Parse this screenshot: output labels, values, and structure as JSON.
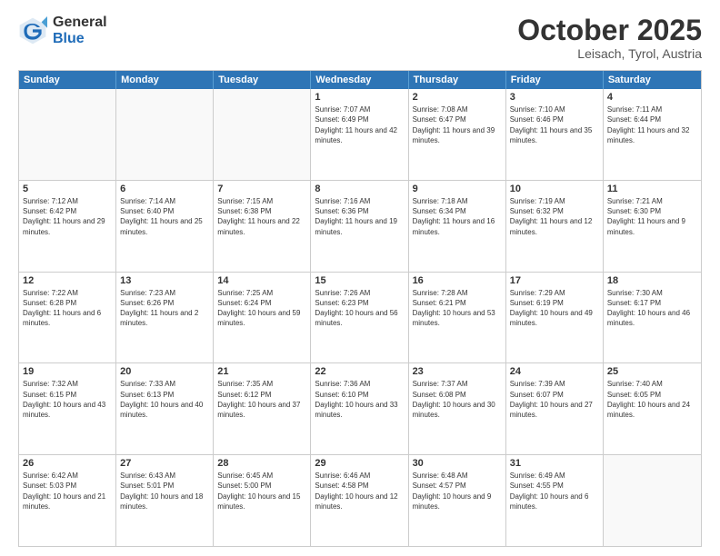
{
  "header": {
    "logo_general": "General",
    "logo_blue": "Blue",
    "month_title": "October 2025",
    "location": "Leisach, Tyrol, Austria"
  },
  "days_of_week": [
    "Sunday",
    "Monday",
    "Tuesday",
    "Wednesday",
    "Thursday",
    "Friday",
    "Saturday"
  ],
  "rows": [
    [
      {
        "day": "",
        "empty": true
      },
      {
        "day": "",
        "empty": true
      },
      {
        "day": "",
        "empty": true
      },
      {
        "day": "1",
        "sunrise": "7:07 AM",
        "sunset": "6:49 PM",
        "daylight": "11 hours and 42 minutes."
      },
      {
        "day": "2",
        "sunrise": "7:08 AM",
        "sunset": "6:47 PM",
        "daylight": "11 hours and 39 minutes."
      },
      {
        "day": "3",
        "sunrise": "7:10 AM",
        "sunset": "6:46 PM",
        "daylight": "11 hours and 35 minutes."
      },
      {
        "day": "4",
        "sunrise": "7:11 AM",
        "sunset": "6:44 PM",
        "daylight": "11 hours and 32 minutes."
      }
    ],
    [
      {
        "day": "5",
        "sunrise": "7:12 AM",
        "sunset": "6:42 PM",
        "daylight": "11 hours and 29 minutes."
      },
      {
        "day": "6",
        "sunrise": "7:14 AM",
        "sunset": "6:40 PM",
        "daylight": "11 hours and 25 minutes."
      },
      {
        "day": "7",
        "sunrise": "7:15 AM",
        "sunset": "6:38 PM",
        "daylight": "11 hours and 22 minutes."
      },
      {
        "day": "8",
        "sunrise": "7:16 AM",
        "sunset": "6:36 PM",
        "daylight": "11 hours and 19 minutes."
      },
      {
        "day": "9",
        "sunrise": "7:18 AM",
        "sunset": "6:34 PM",
        "daylight": "11 hours and 16 minutes."
      },
      {
        "day": "10",
        "sunrise": "7:19 AM",
        "sunset": "6:32 PM",
        "daylight": "11 hours and 12 minutes."
      },
      {
        "day": "11",
        "sunrise": "7:21 AM",
        "sunset": "6:30 PM",
        "daylight": "11 hours and 9 minutes."
      }
    ],
    [
      {
        "day": "12",
        "sunrise": "7:22 AM",
        "sunset": "6:28 PM",
        "daylight": "11 hours and 6 minutes."
      },
      {
        "day": "13",
        "sunrise": "7:23 AM",
        "sunset": "6:26 PM",
        "daylight": "11 hours and 2 minutes."
      },
      {
        "day": "14",
        "sunrise": "7:25 AM",
        "sunset": "6:24 PM",
        "daylight": "10 hours and 59 minutes."
      },
      {
        "day": "15",
        "sunrise": "7:26 AM",
        "sunset": "6:23 PM",
        "daylight": "10 hours and 56 minutes."
      },
      {
        "day": "16",
        "sunrise": "7:28 AM",
        "sunset": "6:21 PM",
        "daylight": "10 hours and 53 minutes."
      },
      {
        "day": "17",
        "sunrise": "7:29 AM",
        "sunset": "6:19 PM",
        "daylight": "10 hours and 49 minutes."
      },
      {
        "day": "18",
        "sunrise": "7:30 AM",
        "sunset": "6:17 PM",
        "daylight": "10 hours and 46 minutes."
      }
    ],
    [
      {
        "day": "19",
        "sunrise": "7:32 AM",
        "sunset": "6:15 PM",
        "daylight": "10 hours and 43 minutes."
      },
      {
        "day": "20",
        "sunrise": "7:33 AM",
        "sunset": "6:13 PM",
        "daylight": "10 hours and 40 minutes."
      },
      {
        "day": "21",
        "sunrise": "7:35 AM",
        "sunset": "6:12 PM",
        "daylight": "10 hours and 37 minutes."
      },
      {
        "day": "22",
        "sunrise": "7:36 AM",
        "sunset": "6:10 PM",
        "daylight": "10 hours and 33 minutes."
      },
      {
        "day": "23",
        "sunrise": "7:37 AM",
        "sunset": "6:08 PM",
        "daylight": "10 hours and 30 minutes."
      },
      {
        "day": "24",
        "sunrise": "7:39 AM",
        "sunset": "6:07 PM",
        "daylight": "10 hours and 27 minutes."
      },
      {
        "day": "25",
        "sunrise": "7:40 AM",
        "sunset": "6:05 PM",
        "daylight": "10 hours and 24 minutes."
      }
    ],
    [
      {
        "day": "26",
        "sunrise": "6:42 AM",
        "sunset": "5:03 PM",
        "daylight": "10 hours and 21 minutes."
      },
      {
        "day": "27",
        "sunrise": "6:43 AM",
        "sunset": "5:01 PM",
        "daylight": "10 hours and 18 minutes."
      },
      {
        "day": "28",
        "sunrise": "6:45 AM",
        "sunset": "5:00 PM",
        "daylight": "10 hours and 15 minutes."
      },
      {
        "day": "29",
        "sunrise": "6:46 AM",
        "sunset": "4:58 PM",
        "daylight": "10 hours and 12 minutes."
      },
      {
        "day": "30",
        "sunrise": "6:48 AM",
        "sunset": "4:57 PM",
        "daylight": "10 hours and 9 minutes."
      },
      {
        "day": "31",
        "sunrise": "6:49 AM",
        "sunset": "4:55 PM",
        "daylight": "10 hours and 6 minutes."
      },
      {
        "day": "",
        "empty": true
      }
    ]
  ]
}
